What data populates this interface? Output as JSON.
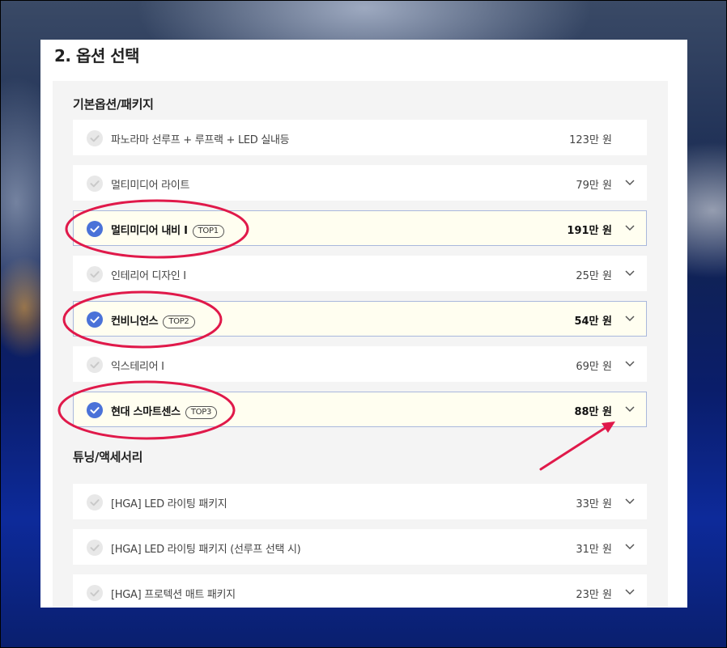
{
  "section_title": "2. 옵션 선택",
  "groups": [
    {
      "title": "기본옵션/패키지",
      "items": [
        {
          "label": "파노라마 선루프 + 루프랙 + LED 실내등",
          "price": "123만 원",
          "selected": false,
          "expandable": false,
          "badge": ""
        },
        {
          "label": "멀티미디어 라이트",
          "price": "79만 원",
          "selected": false,
          "expandable": true,
          "badge": ""
        },
        {
          "label": "멀티미디어 내비 I",
          "price": "191만 원",
          "selected": true,
          "expandable": true,
          "badge": "TOP1"
        },
        {
          "label": "인테리어 디자인 I",
          "price": "25만 원",
          "selected": false,
          "expandable": true,
          "badge": ""
        },
        {
          "label": "컨비니언스",
          "price": "54만 원",
          "selected": true,
          "expandable": true,
          "badge": "TOP2"
        },
        {
          "label": "익스테리어 I",
          "price": "69만 원",
          "selected": false,
          "expandable": true,
          "badge": ""
        },
        {
          "label": "현대 스마트센스",
          "price": "88만 원",
          "selected": true,
          "expandable": true,
          "badge": "TOP3"
        }
      ]
    },
    {
      "title": "튜닝/액세서리",
      "items": [
        {
          "label": "[HGA] LED 라이팅 패키지",
          "price": "33만 원",
          "selected": false,
          "expandable": true,
          "badge": ""
        },
        {
          "label": "[HGA] LED 라이팅 패키지 (선루프 선택 시)",
          "price": "31만 원",
          "selected": false,
          "expandable": true,
          "badge": ""
        },
        {
          "label": "[HGA] 프로텍션 매트 패키지",
          "price": "23만 원",
          "selected": false,
          "expandable": true,
          "badge": ""
        }
      ]
    }
  ],
  "colors": {
    "check_selected": "#4a72d8",
    "check_unselected": "#e8e8e8",
    "selected_row_bg": "#fffef0",
    "selected_row_border": "#a9b8dc",
    "annotation": "#e0194a"
  },
  "icons": {
    "check": "check-icon",
    "expand": "chevron-down-icon"
  }
}
